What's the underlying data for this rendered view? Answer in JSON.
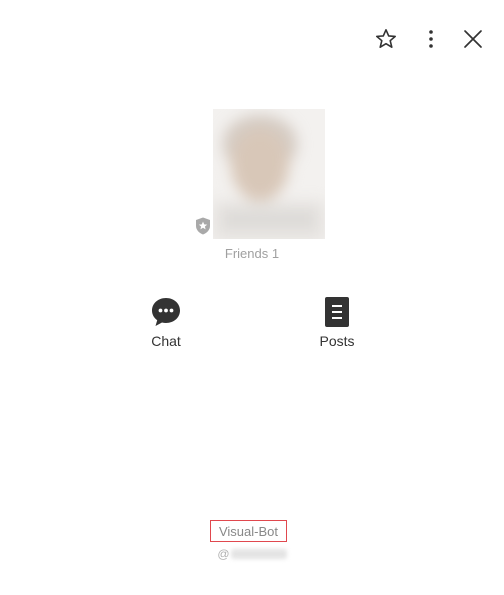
{
  "header": {
    "favorite_icon": "star-outline-icon",
    "more_icon": "vertical-dots-icon",
    "close_icon": "close-x-icon"
  },
  "profile": {
    "badge_icon": "shield-star-icon",
    "friends_label": "Friends 1",
    "display_name": "Visual-Bot",
    "handle_prefix": "@"
  },
  "actions": [
    {
      "label": "Chat",
      "icon": "chat-bubble-icon"
    },
    {
      "label": "Posts",
      "icon": "document-icon"
    }
  ],
  "colors": {
    "icon_dark": "#333333",
    "highlight_border": "#e0484e",
    "muted_text": "#a0a0a0"
  }
}
